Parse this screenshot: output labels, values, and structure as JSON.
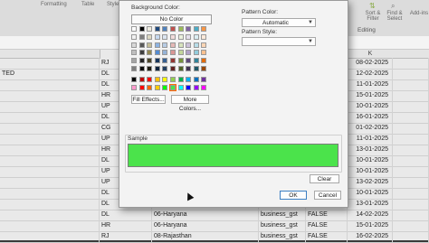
{
  "ribbon": {
    "tabs": [
      "Formatting",
      "Table",
      "Styles"
    ],
    "sort_filter_label": "Sort & Filter",
    "find_select_label": "Find & Select",
    "addins_label": "Add-ins",
    "group_label": "Editing"
  },
  "columns": [
    "K"
  ],
  "rows": [
    {
      "c0": "",
      "c1": "RJ",
      "c2": "",
      "c3": "",
      "c4": "",
      "date": "08-02-2025"
    },
    {
      "c0": "TED",
      "c1": "DL",
      "c2": "",
      "c3": "",
      "c4": "",
      "date": "12-02-2025"
    },
    {
      "c0": "",
      "c1": "DL",
      "c2": "",
      "c3": "",
      "c4": "",
      "date": "11-01-2025"
    },
    {
      "c0": "",
      "c1": "HR",
      "c2": "",
      "c3": "",
      "c4": "",
      "date": "15-01-2025"
    },
    {
      "c0": "",
      "c1": "UP",
      "c2": "",
      "c3": "",
      "c4": "",
      "date": "10-01-2025"
    },
    {
      "c0": "",
      "c1": "DL",
      "c2": "",
      "c3": "",
      "c4": "",
      "date": "16-01-2025"
    },
    {
      "c0": "",
      "c1": "CG",
      "c2": "",
      "c3": "",
      "c4": "",
      "date": "01-02-2025"
    },
    {
      "c0": "",
      "c1": "UP",
      "c2": "",
      "c3": "",
      "c4": "",
      "date": "11-01-2025"
    },
    {
      "c0": "",
      "c1": "HR",
      "c2": "",
      "c3": "",
      "c4": "",
      "date": "13-01-2025"
    },
    {
      "c0": "",
      "c1": "DL",
      "c2": "",
      "c3": "",
      "c4": "",
      "date": "10-01-2025"
    },
    {
      "c0": "",
      "c1": "UP",
      "c2": "",
      "c3": "",
      "c4": "",
      "date": "10-01-2025"
    },
    {
      "c0": "",
      "c1": "UP",
      "c2": "",
      "c3": "",
      "c4": "",
      "date": "13-02-2025"
    },
    {
      "c0": "",
      "c1": "DL",
      "c2": "",
      "c3": "",
      "c4": "",
      "date": "10-01-2025"
    },
    {
      "c0": "",
      "c1": "DL",
      "c2": "",
      "c3": "",
      "c4": "",
      "date": "13-01-2025"
    },
    {
      "c0": "",
      "c1": "DL",
      "c2": "06-Haryana",
      "c3": "business_gst",
      "c4": "FALSE",
      "date": "14-02-2025"
    },
    {
      "c0": "",
      "c1": "HR",
      "c2": "06-Haryana",
      "c3": "business_gst",
      "c4": "FALSE",
      "date": "15-01-2025"
    },
    {
      "c0": "",
      "c1": "RJ",
      "c2": "08-Rajasthan",
      "c3": "business_gst",
      "c4": "FALSE",
      "date": "16-02-2025"
    }
  ],
  "dialog": {
    "background_color_label": "Background Color:",
    "no_color_label": "No Color",
    "pattern_color_label": "Pattern Color:",
    "pattern_color_value": "Automatic",
    "pattern_style_label": "Pattern Style:",
    "pattern_style_value": "",
    "fill_effects_label": "Fill Effects...",
    "more_colors_label": "More Colors...",
    "sample_label": "Sample",
    "sample_color": "#4be34b",
    "clear_label": "Clear",
    "ok_label": "OK",
    "cancel_label": "Cancel"
  },
  "palette_rows": [
    [
      "#ffffff",
      "#000000",
      "#eeece1",
      "#1f497d",
      "#4f81bd",
      "#c0504d",
      "#9bbb59",
      "#8064a2",
      "#4bacc6",
      "#f79646"
    ],
    [
      "#f2f2f2",
      "#7f7f7f",
      "#ddd9c3",
      "#c6d9f0",
      "#dbe5f1",
      "#f2dcdb",
      "#ebf1dd",
      "#e5e0ec",
      "#dbeef3",
      "#fdeada"
    ],
    [
      "#d8d8d8",
      "#595959",
      "#c4bd97",
      "#8db3e2",
      "#b8cce4",
      "#e5b9b7",
      "#d7e3bc",
      "#ccc1d9",
      "#b7dde8",
      "#fbd5b5"
    ],
    [
      "#bfbfbf",
      "#3f3f3f",
      "#938953",
      "#548dd4",
      "#95b3d7",
      "#d99694",
      "#c3d69b",
      "#b2a2c7",
      "#92cddc",
      "#fac08f"
    ],
    [
      "#a5a5a5",
      "#262626",
      "#494429",
      "#17365d",
      "#366092",
      "#953734",
      "#76923c",
      "#5f497a",
      "#31859b",
      "#e36c09"
    ],
    [
      "#7f7f7f",
      "#0c0c0c",
      "#1d1b10",
      "#0f243e",
      "#244061",
      "#632423",
      "#4f6128",
      "#3f3151",
      "#205867",
      "#974806"
    ],
    [
      "#000000",
      "#c00000",
      "#ff0000",
      "#ffc000",
      "#ffff00",
      "#92d050",
      "#00b050",
      "#00b0f0",
      "#0070c0",
      "#7030a0"
    ],
    [
      "#ff99cc",
      "#ff0000",
      "#ff6600",
      "#ffcc00",
      "#00ff00",
      "#4be34b",
      "#00ffff",
      "#0000ff",
      "#9900ff",
      "#ff00ff"
    ]
  ]
}
